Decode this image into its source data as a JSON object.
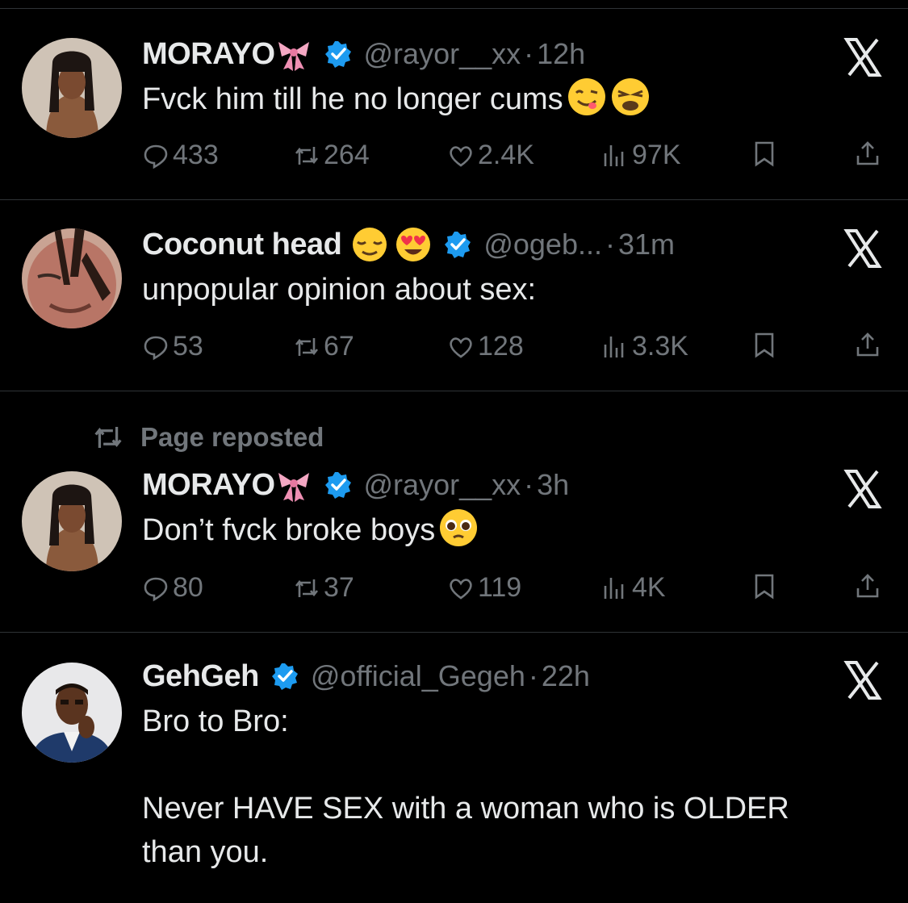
{
  "tweets": [
    {
      "name": "MORAYO",
      "handle": "@rayor__xx",
      "dot": "·",
      "time": "12h",
      "text": "Fvck him till he no longer cums",
      "name_emojis": [
        "ribbon-emoji"
      ],
      "text_emojis": [
        "face-savoring-food-emoji",
        "weary-face-emoji"
      ],
      "replies": "433",
      "reposts": "264",
      "likes": "2.4K",
      "views": "97K"
    },
    {
      "name": "Coconut head",
      "handle": "@ogeb...",
      "dot": "·",
      "time": "31m",
      "text": "unpopular opinion about sex:",
      "name_emojis": [
        "relieved-face-emoji",
        "heart-eyes-emoji"
      ],
      "text_emojis": [],
      "replies": "53",
      "reposts": "67",
      "likes": "128",
      "views": "3.3K"
    },
    {
      "context": "Page reposted",
      "name": "MORAYO",
      "handle": "@rayor__xx",
      "dot": "·",
      "time": "3h",
      "text": "Don’t fvck broke boys",
      "name_emojis": [
        "ribbon-emoji"
      ],
      "text_emojis": [
        "pleading-face-emoji"
      ],
      "replies": "80",
      "reposts": "37",
      "likes": "119",
      "views": "4K"
    },
    {
      "name": "GehGeh",
      "handle": "@official_Gegeh",
      "dot": "·",
      "time": "22h",
      "text_line1": "Bro to Bro:",
      "text_line2": "Never HAVE SEX with a woman who is OLDER",
      "text_line3": "than you."
    }
  ],
  "colors": {
    "background": "#000000",
    "text": "#e7e9ea",
    "muted": "#71767b",
    "divider": "#2f3336",
    "verified": "#1d9bf0"
  }
}
